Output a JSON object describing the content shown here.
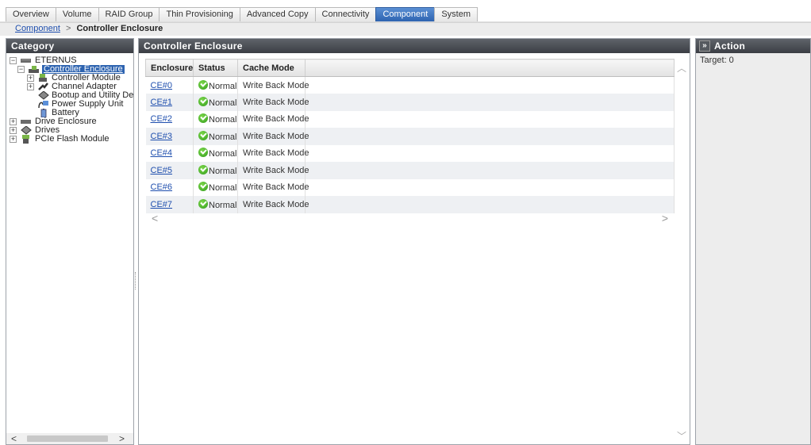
{
  "tabs": [
    {
      "label": "Overview"
    },
    {
      "label": "Volume"
    },
    {
      "label": "RAID Group"
    },
    {
      "label": "Thin Provisioning"
    },
    {
      "label": "Advanced Copy"
    },
    {
      "label": "Connectivity"
    },
    {
      "label": "Component",
      "active": true
    },
    {
      "label": "System"
    }
  ],
  "breadcrumb": {
    "parent": "Component",
    "separator": ">",
    "current": "Controller Enclosure"
  },
  "category": {
    "title": "Category",
    "tree": [
      {
        "label": "ETERNUS",
        "toggle": "⊟",
        "icon": "storage-system-icon"
      },
      {
        "label": "Controller Enclosure",
        "toggle": "⊟",
        "icon": "controller-enclosure-icon",
        "selected": true
      },
      {
        "label": "Controller Module",
        "toggle": "⊞",
        "icon": "controller-module-icon"
      },
      {
        "label": "Channel Adapter",
        "toggle": "⊞",
        "icon": "channel-adapter-icon"
      },
      {
        "label": "Bootup and Utility De",
        "icon": "bootup-utility-device-icon"
      },
      {
        "label": "Power Supply Unit",
        "icon": "power-supply-icon"
      },
      {
        "label": "Battery",
        "icon": "battery-icon"
      },
      {
        "label": "Drive Enclosure",
        "toggle": "⊞",
        "icon": "drive-enclosure-icon"
      },
      {
        "label": "Drives",
        "toggle": "⊞",
        "icon": "drives-icon"
      },
      {
        "label": "PCIe Flash Module",
        "toggle": "⊞",
        "icon": "pcie-flash-module-icon"
      }
    ]
  },
  "content": {
    "title": "Controller Enclosure",
    "columns": [
      "Enclosure",
      "Status",
      "Cache Mode"
    ],
    "rows": [
      {
        "enclosure": "CE#0",
        "status": "Normal",
        "cache_mode": "Write Back Mode"
      },
      {
        "enclosure": "CE#1",
        "status": "Normal",
        "cache_mode": "Write Back Mode"
      },
      {
        "enclosure": "CE#2",
        "status": "Normal",
        "cache_mode": "Write Back Mode"
      },
      {
        "enclosure": "CE#3",
        "status": "Normal",
        "cache_mode": "Write Back Mode"
      },
      {
        "enclosure": "CE#4",
        "status": "Normal",
        "cache_mode": "Write Back Mode"
      },
      {
        "enclosure": "CE#5",
        "status": "Normal",
        "cache_mode": "Write Back Mode"
      },
      {
        "enclosure": "CE#6",
        "status": "Normal",
        "cache_mode": "Write Back Mode"
      },
      {
        "enclosure": "CE#7",
        "status": "Normal",
        "cache_mode": "Write Back Mode"
      }
    ]
  },
  "action": {
    "title": "Action",
    "expand_glyph": "»",
    "target_text": "Target: 0"
  },
  "scroll_glyphs": {
    "left": "<",
    "right": ">",
    "up": "︿",
    "down": "﹀"
  },
  "colors": {
    "accent": "#2d63b0",
    "header_dark": "#3b3e44",
    "status_ok": "#2f9b1a"
  }
}
